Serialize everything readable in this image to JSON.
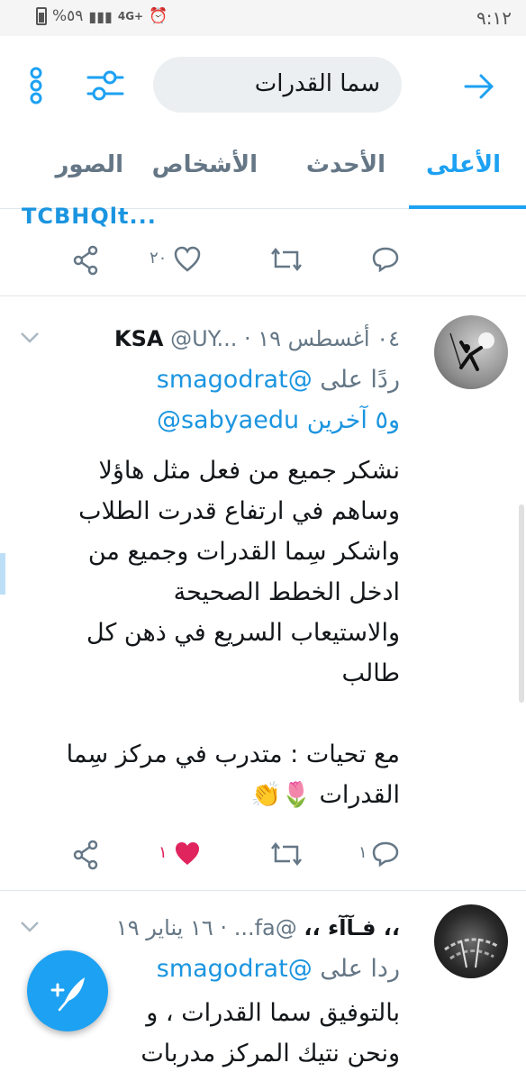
{
  "status": {
    "time": "٩:١٢",
    "battery": "%٥٩",
    "network": "4G+"
  },
  "search": {
    "query": "سما القدرات"
  },
  "tabs": [
    {
      "label": "الأعلى",
      "active": true
    },
    {
      "label": "الأحدث"
    },
    {
      "label": "الأشخاص"
    },
    {
      "label": "الصور"
    }
  ],
  "prev_tweet": {
    "cut_text": "TCBHQlt...",
    "like_count": "٢٠"
  },
  "tweet1": {
    "name": "KSA",
    "handle": "@UY...",
    "dot": "·",
    "date": "٠٤ أغسطس ١٩",
    "reply_prefix": "ردًا على",
    "reply_to": "@smagodrat",
    "reply_to2": "@sabyaedu",
    "reply_others": "و٥ آخرين",
    "text": "نشكر جميع من فعل مثل هاؤلا\nوساهم في ارتفاع قدرت الطلاب\nواشكر سِما القدرات وجميع من\nادخل الخطط الصحيحة\nوالاستيعاب السريع في ذهن كل\nطالب\n\nمع تحيات : متدرب في مركز سِما\nالقدرات 🌷👏",
    "reply_count": "١",
    "like_count": "١"
  },
  "tweet2": {
    "name": "،، فـآآء ،،",
    "handle": "@fa...",
    "dot": "·",
    "date": "١٦ يناير ١٩",
    "reply_prefix": "ردا على",
    "reply_to": "@smagodrat",
    "text": "بالتوفيق سما القدرات ، و\nونحن نتيك المركز مدربات"
  },
  "colors": {
    "accent": "#1da1f2",
    "like": "#e0245e",
    "muted": "#657786"
  }
}
